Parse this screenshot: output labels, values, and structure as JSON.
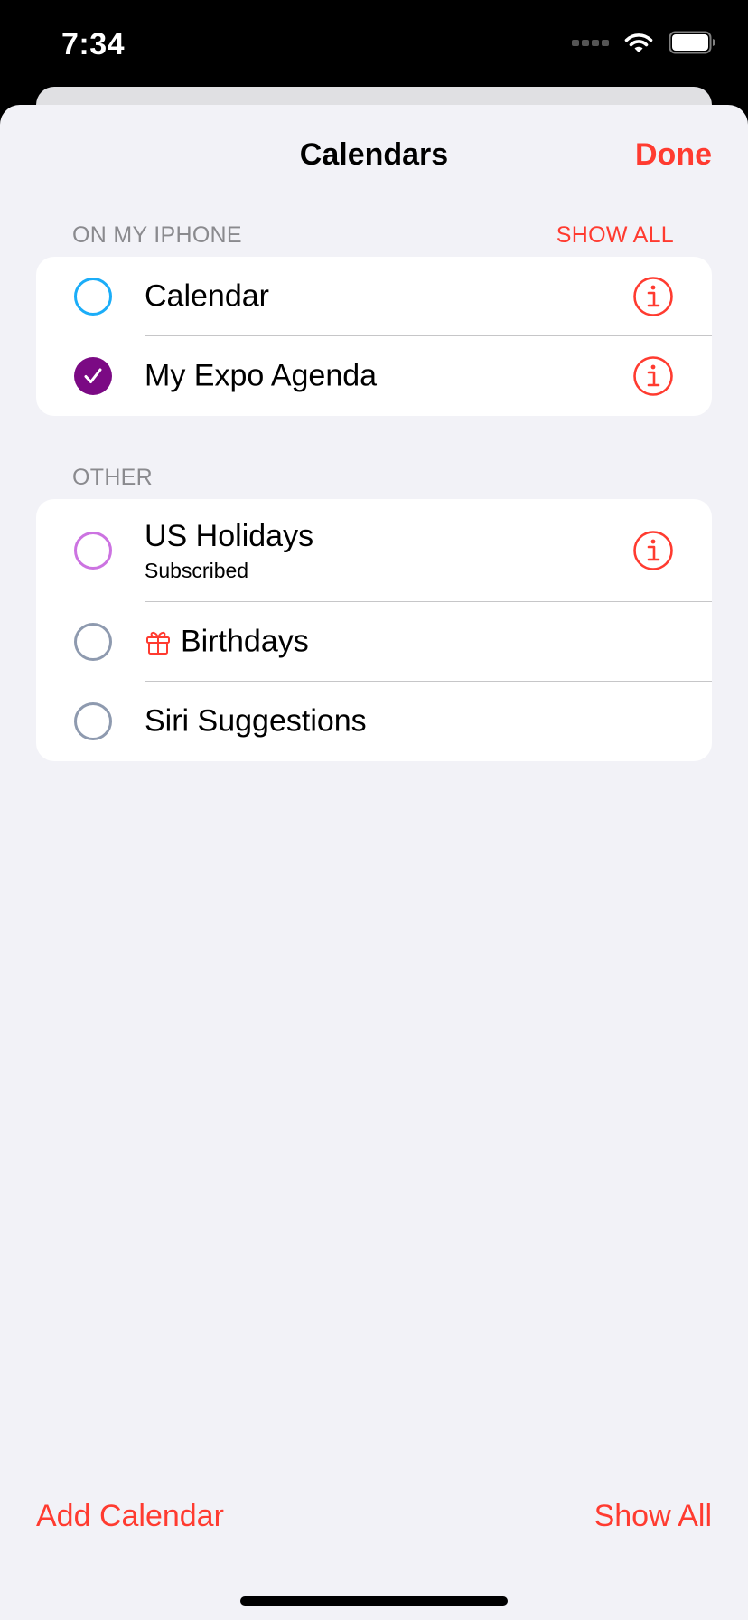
{
  "status_bar": {
    "time": "7:34"
  },
  "header": {
    "title": "Calendars",
    "done_label": "Done"
  },
  "sections": {
    "on_my_iphone": {
      "header": "ON MY IPHONE",
      "action": "SHOW ALL",
      "rows": [
        {
          "label": "Calendar",
          "color": "#1badf8",
          "checked": false
        },
        {
          "label": "My Expo Agenda",
          "color": "#7b0a84",
          "checked": true
        }
      ]
    },
    "other": {
      "header": "OTHER",
      "rows": [
        {
          "label": "US Holidays",
          "subtitle": "Subscribed",
          "color": "#cc73e1",
          "checked": false
        },
        {
          "label": "Birthdays",
          "icon": "gift-icon",
          "color": "#8e9aaf",
          "checked": false
        },
        {
          "label": "Siri Suggestions",
          "color": "#8e9aaf",
          "checked": false
        }
      ]
    }
  },
  "footer": {
    "add_label": "Add Calendar",
    "show_all_label": "Show All"
  },
  "colors": {
    "accent": "#ff3b30",
    "background": "#f2f2f7"
  }
}
